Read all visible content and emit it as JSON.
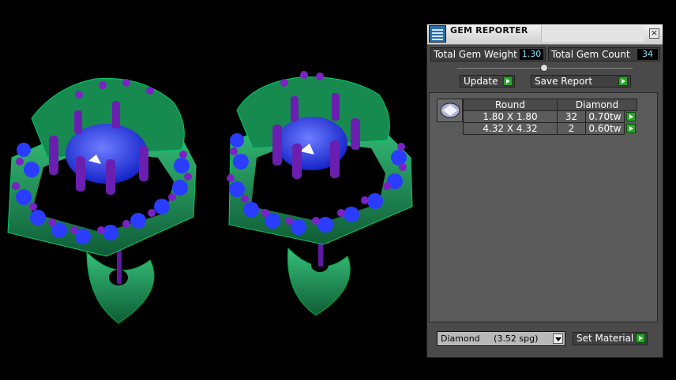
{
  "panel": {
    "title": "GEM REPORTER",
    "close_glyph": "×",
    "total_weight_label": "Total Gem Weight",
    "total_weight_value": "1.30",
    "total_count_label": "Total Gem Count",
    "total_count_value": "34",
    "update_label": "Update",
    "save_report_label": "Save Report",
    "columns": [
      "Round",
      "Diamond"
    ],
    "rows": [
      {
        "size": "1.80 X 1.80",
        "count": "32",
        "weight": "0.70tw"
      },
      {
        "size": "4.32 X 4.32",
        "count": "2",
        "weight": "0.60tw"
      }
    ],
    "material_select": "Diamond     (3.52 spg)",
    "set_material_label": "Set Material"
  },
  "colors": {
    "accent_go": "#2ca52c",
    "value_text": "#7ee6ff",
    "model_green": "#1f9a5a",
    "gem_blue": "#2a3cff",
    "prong_purple": "#6a1fb0"
  }
}
